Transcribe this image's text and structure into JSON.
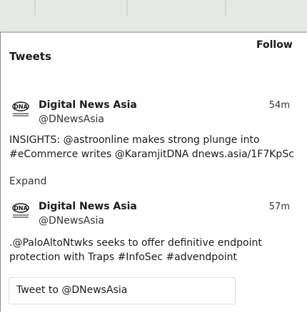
{
  "widget": {
    "title": "Tweets",
    "follow_label": "Follow",
    "compose_label": "Tweet to @DNewsAsia"
  },
  "tweets": [
    {
      "name": "Digital News Asia",
      "handle": "@DNewsAsia",
      "time": "54m",
      "text": "INSIGHTS: @astroonline makes strong plunge into #eCommerce writes @KaramjitDNA dnews.asia/1F7KpSc",
      "expand": "Expand",
      "avatar_icon": "dna-logo-icon"
    },
    {
      "name": "Digital News Asia",
      "handle": "@DNewsAsia",
      "time": "57m",
      "text": ".@PaloAltoNtwks seeks to offer definitive endpoint protection with Traps #InfoSec #advendpoint",
      "avatar_icon": "dna-logo-icon"
    }
  ],
  "colors": {
    "text": "#1a1a1a",
    "logo": "#1a1a1a"
  }
}
